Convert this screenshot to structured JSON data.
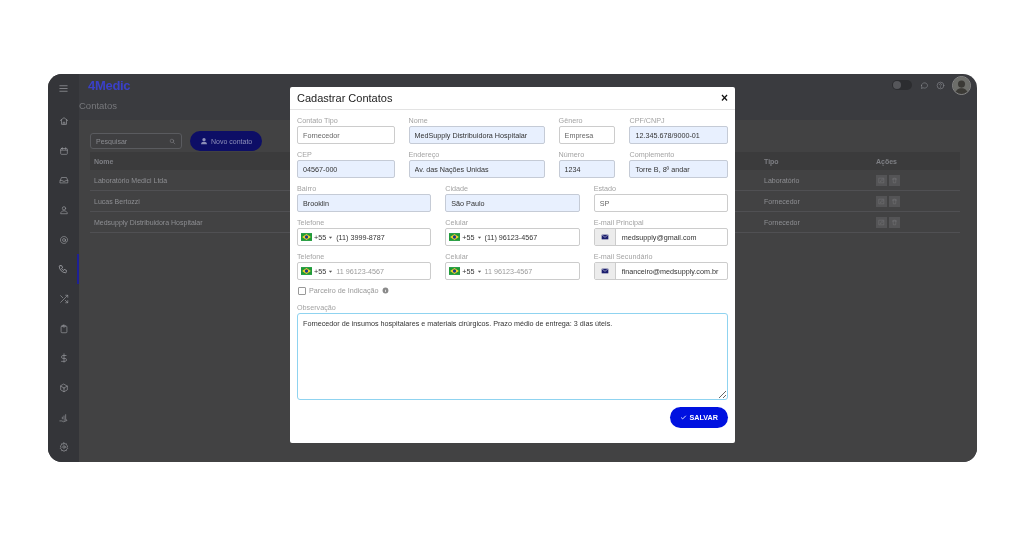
{
  "app": {
    "logo": "4Medic",
    "page_title": "Contatos",
    "search": {
      "placeholder": "Pesquisar"
    },
    "new_button": "Novo contato",
    "theme_toggle": {
      "on": false
    },
    "sidebar": {
      "items": [
        {
          "selected": false
        },
        {
          "selected": false
        },
        {
          "selected": false
        },
        {
          "selected": false
        },
        {
          "selected": false
        },
        {
          "selected": true
        },
        {
          "selected": false
        },
        {
          "selected": false
        },
        {
          "selected": false
        },
        {
          "selected": false
        },
        {
          "selected": false
        },
        {
          "selected": false
        }
      ]
    },
    "table": {
      "columns": [
        "Nome",
        "Tipo",
        "Ações"
      ],
      "rows": [
        {
          "name": "Laboratório Medici Ltda",
          "tipo": "Laboratório"
        },
        {
          "name": "Lucas Bertozzi",
          "tipo": "Fornecedor"
        },
        {
          "name": "Medsupply Distribuidora Hospitalar",
          "tipo": "Fornecedor"
        }
      ]
    }
  },
  "modal": {
    "title": "Cadastrar Contatos",
    "close": "×",
    "rows": [
      {
        "fields": [
          {
            "kind": "text",
            "label": "Contato Tipo",
            "value": "Fornecedor",
            "highlighted": false
          },
          {
            "kind": "text",
            "label": "Nome",
            "value": "MedSupply Distribuidora Hospitalar",
            "highlighted": true
          },
          {
            "kind": "text",
            "label": "Gênero",
            "value": "Empresa",
            "highlighted": false
          },
          {
            "kind": "text",
            "label": "CPF/CNPJ",
            "value": "12.345.678/9000-01",
            "highlighted": true
          }
        ]
      },
      {
        "fields": [
          {
            "kind": "text",
            "label": "CEP",
            "value": "04567-000",
            "highlighted": true
          },
          {
            "kind": "text",
            "label": "Endereço",
            "value": "Av. das Nações Unidas",
            "highlighted": true
          },
          {
            "kind": "text",
            "label": "Número",
            "value": "1234",
            "highlighted": true
          },
          {
            "kind": "text",
            "label": "Complemento",
            "value": "Torre B, 8º andar",
            "highlighted": true
          }
        ]
      },
      {
        "fields": [
          {
            "kind": "text",
            "label": "Bairro",
            "value": "Brooklin",
            "highlighted": true
          },
          {
            "kind": "text",
            "label": "Cidade",
            "value": "São Paulo",
            "highlighted": true
          },
          {
            "kind": "text",
            "label": "Estado",
            "value": "SP",
            "highlighted": false
          }
        ]
      },
      {
        "fields": [
          {
            "kind": "phone",
            "label": "Telefone",
            "code": "+55",
            "value": "(11) 3999-8787"
          },
          {
            "kind": "phone",
            "label": "Celular",
            "code": "+55",
            "value": "(11) 96123-4567"
          },
          {
            "kind": "email",
            "label": "E-mail Principal",
            "value": "medsupply@gmail.com"
          }
        ]
      },
      {
        "fields": [
          {
            "kind": "phone",
            "label": "Telefone",
            "code": "+55",
            "placeholder": "11 96123-4567"
          },
          {
            "kind": "phone",
            "label": "Celular",
            "code": "+55",
            "placeholder": "11 96123-4567"
          },
          {
            "kind": "email",
            "label": "E-mail Secundário",
            "value": "financeiro@medsupply.com.br"
          }
        ]
      }
    ],
    "partner": {
      "label": "Parceiro de Indicação",
      "checked": false
    },
    "notes": {
      "label": "Observação",
      "value": "Fornecedor de insumos hospitalares e materiais cirúrgicos. Prazo médio de entrega: 3 dias úteis."
    },
    "save_button": "SALVAR"
  }
}
